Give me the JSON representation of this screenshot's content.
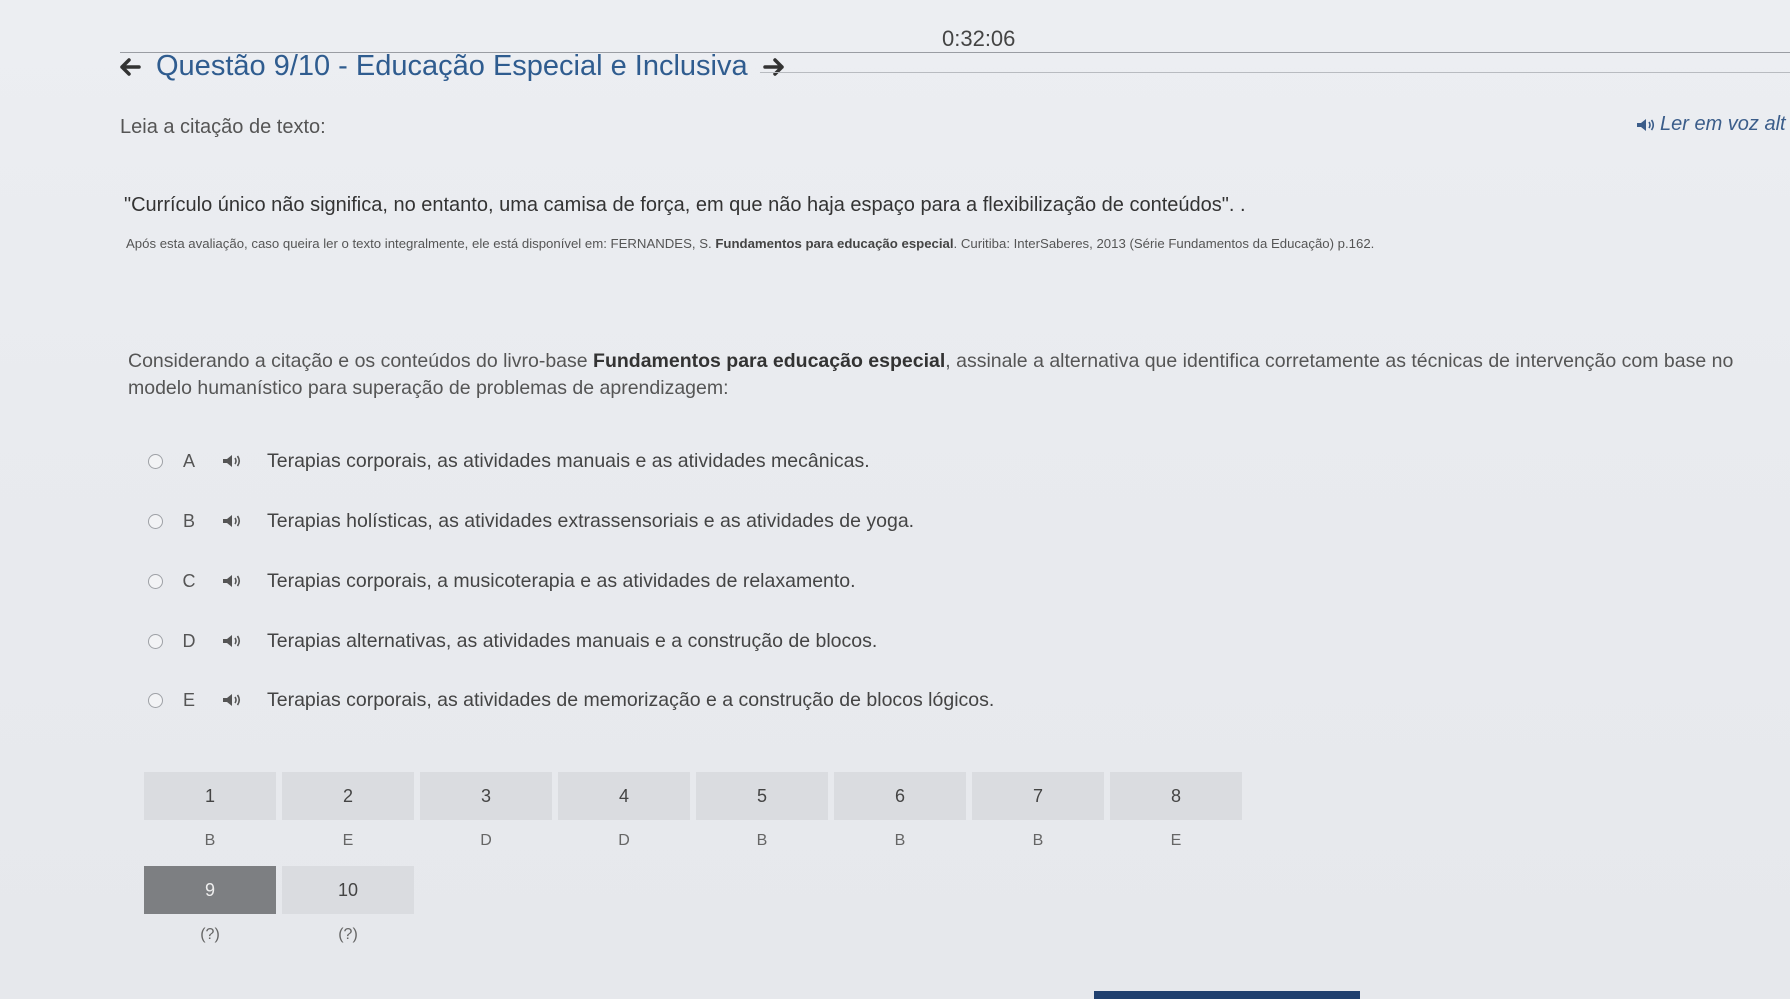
{
  "timer": "0:32:06",
  "header": {
    "title": "Questão 9/10 - Educação Especial e Inclusiva"
  },
  "instruction": "Leia a citação de texto:",
  "read_aloud_label": "Ler em voz alt",
  "quote": "\"Currículo único não significa, no entanto, uma camisa de força, em que não haja espaço para a flexibilização de conteúdos\". .",
  "reference": {
    "prefix": "Após esta avaliação, caso queira ler o texto integralmente, ele está disponível em: FERNANDES, S. ",
    "bold": "Fundamentos para educação especial",
    "suffix": ". Curitiba: InterSaberes, 2013 (Série Fundamentos da Educação) p.162."
  },
  "question": {
    "prefix": "Considerando a citação e os conteúdos do livro-base ",
    "bold": "Fundamentos para educação especial",
    "suffix": ", assinale a alternativa que identifica corretamente as técnicas de intervenção com base no modelo humanístico para superação de problemas de aprendizagem:"
  },
  "options": [
    {
      "letter": "A",
      "text": "Terapias corporais, as atividades manuais e as atividades mecânicas."
    },
    {
      "letter": "B",
      "text": "Terapias holísticas, as atividades extrassensoriais e as atividades de yoga."
    },
    {
      "letter": "C",
      "text": "Terapias corporais, a musicoterapia e as atividades de relaxamento."
    },
    {
      "letter": "D",
      "text": "Terapias alternativas, as atividades manuais e a  construção de blocos."
    },
    {
      "letter": "E",
      "text": "Terapias corporais, as atividades de memorização e a construção de blocos lógicos."
    }
  ],
  "navigation": {
    "row1": [
      {
        "num": "1",
        "answer": "B"
      },
      {
        "num": "2",
        "answer": "E"
      },
      {
        "num": "3",
        "answer": "D"
      },
      {
        "num": "4",
        "answer": "D"
      },
      {
        "num": "5",
        "answer": "B"
      },
      {
        "num": "6",
        "answer": "B"
      },
      {
        "num": "7",
        "answer": "B"
      },
      {
        "num": "8",
        "answer": "E"
      }
    ],
    "row2": [
      {
        "num": "9",
        "answer": "(?)",
        "active": true
      },
      {
        "num": "10",
        "answer": "(?)"
      }
    ]
  },
  "icons": {
    "back": "arrow-left-icon",
    "forward": "arrow-right-icon",
    "speaker": "speaker-icon"
  },
  "colors": {
    "title": "#2f5c8f",
    "active_question": "#7d7f82",
    "bottom_bar": "#1f3f6e"
  }
}
